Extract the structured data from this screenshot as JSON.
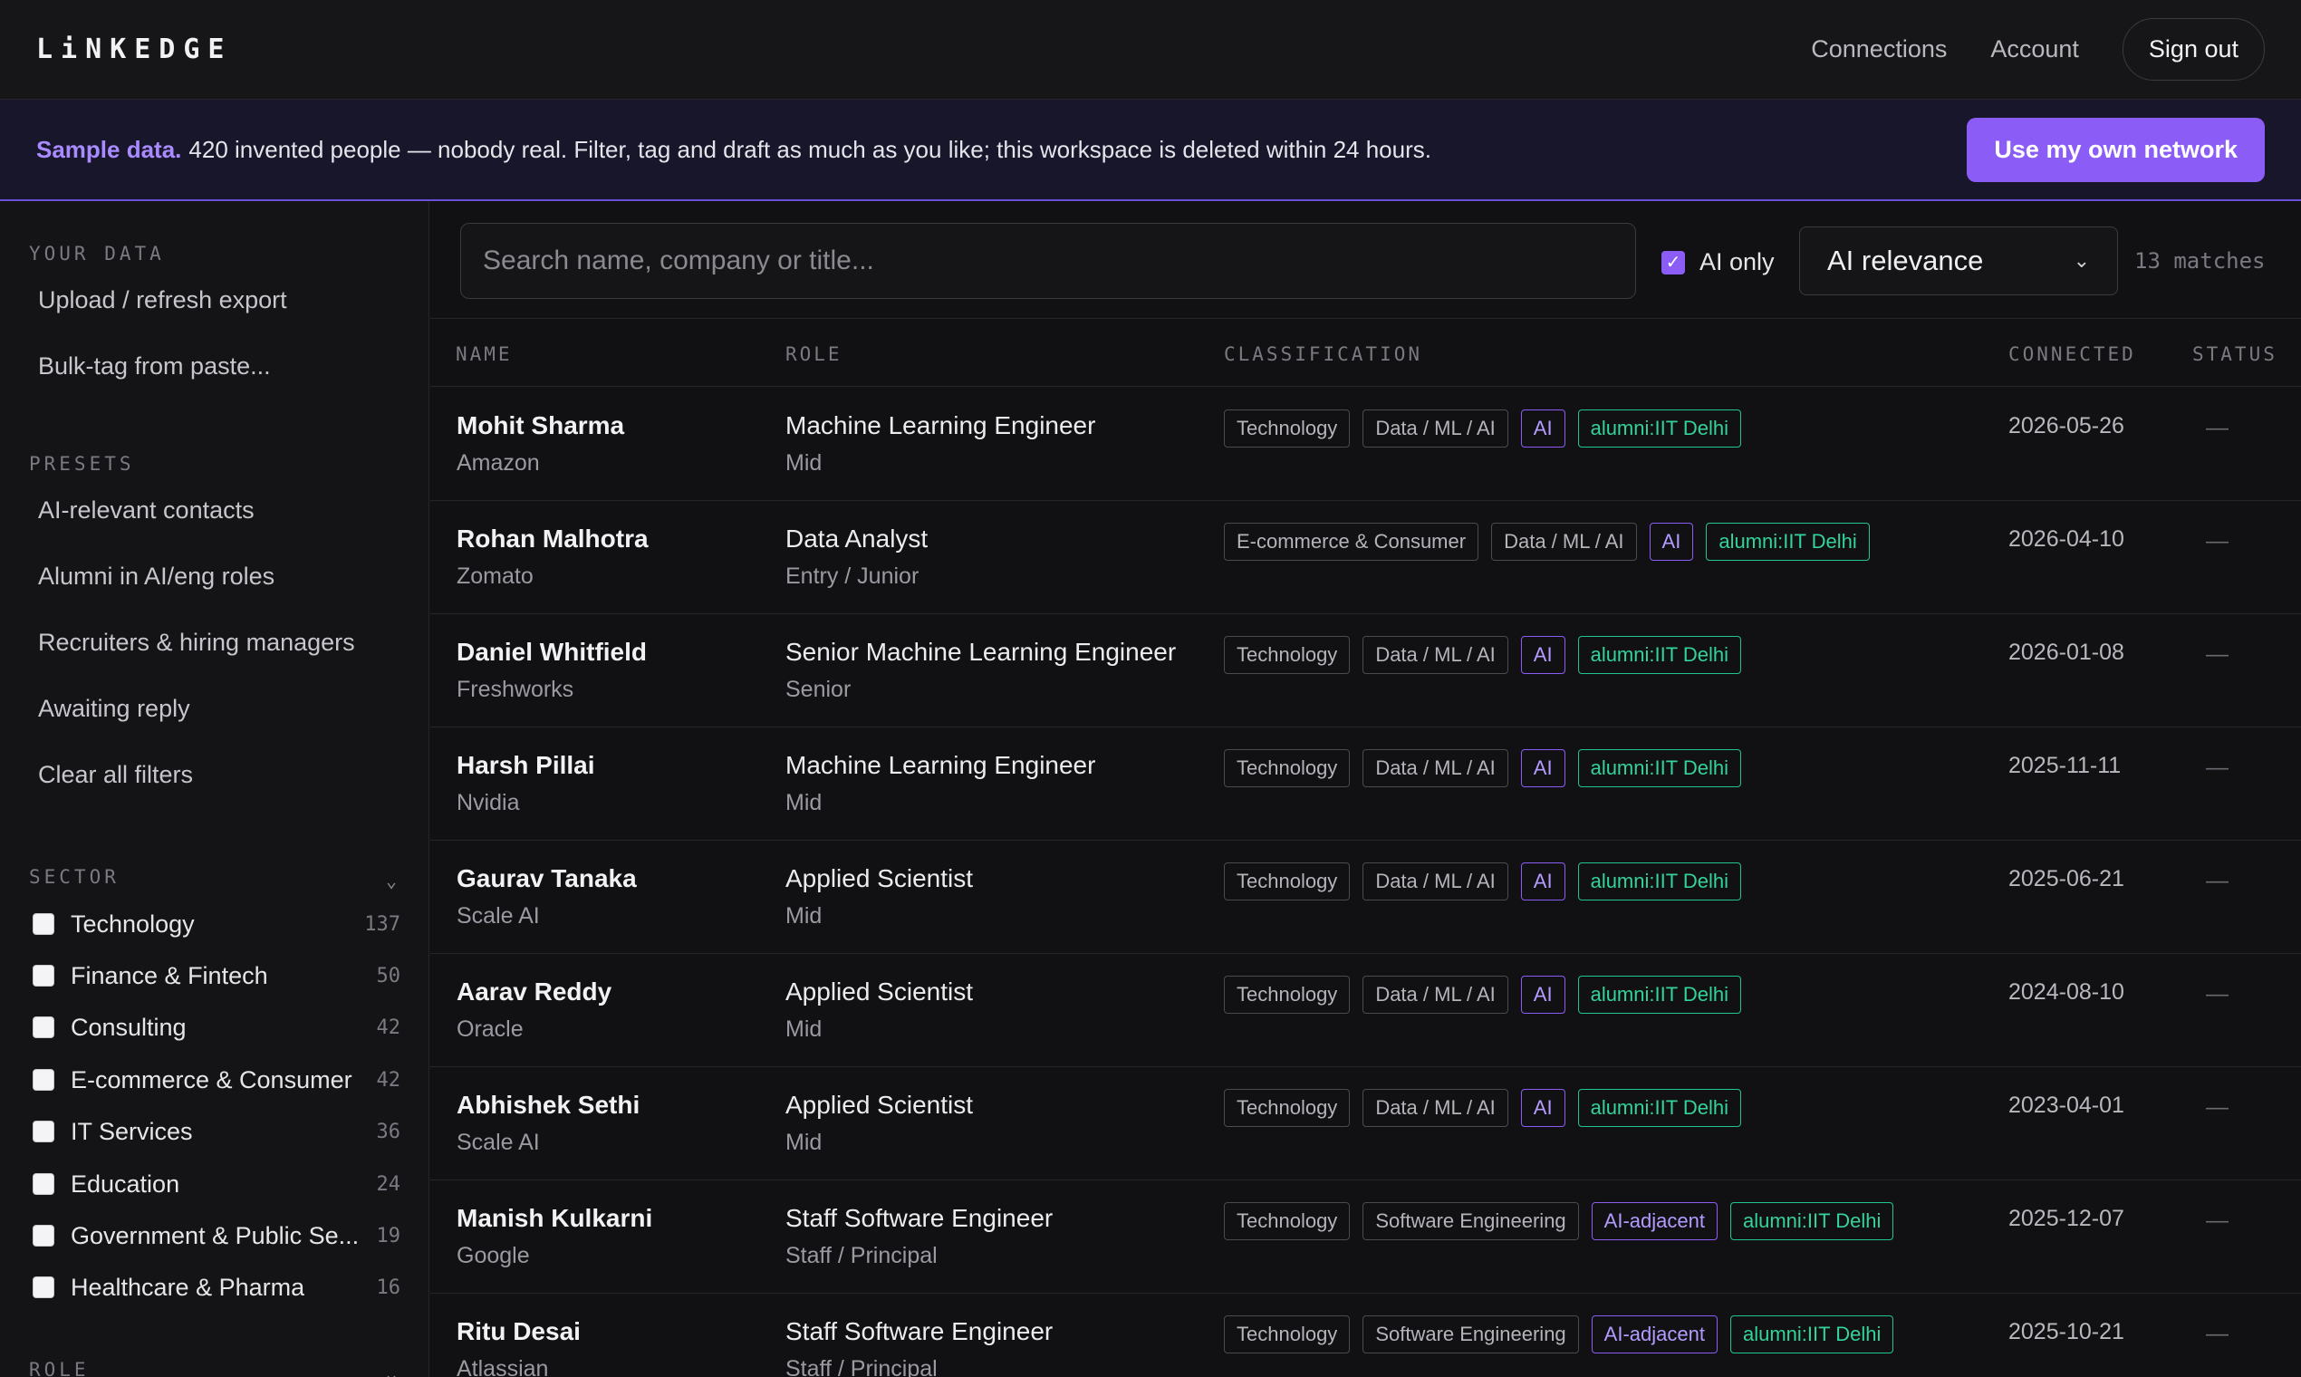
{
  "app": {
    "logo": "LiNKEDGE"
  },
  "header": {
    "nav": [
      "Connections",
      "Account"
    ],
    "signout_label": "Sign out"
  },
  "banner": {
    "strong": "Sample data.",
    "text": "420 invented people — nobody real. Filter, tag and draft as much as you like; this workspace is deleted within 24 hours.",
    "button_label": "Use my own network"
  },
  "sidebar": {
    "your_data": {
      "label": "YOUR DATA",
      "items": [
        "Upload / refresh export",
        "Bulk-tag from paste..."
      ]
    },
    "presets": {
      "label": "PRESETS",
      "items": [
        "AI-relevant contacts",
        "Alumni in AI/eng roles",
        "Recruiters & hiring managers",
        "Awaiting reply",
        "Clear all filters"
      ]
    },
    "sector": {
      "label": "SECTOR",
      "items": [
        {
          "label": "Technology",
          "count": "137"
        },
        {
          "label": "Finance & Fintech",
          "count": "50"
        },
        {
          "label": "Consulting",
          "count": "42"
        },
        {
          "label": "E-commerce & Consumer",
          "count": "42"
        },
        {
          "label": "IT Services",
          "count": "36"
        },
        {
          "label": "Education",
          "count": "24"
        },
        {
          "label": "Government & Public Se...",
          "count": "19"
        },
        {
          "label": "Healthcare & Pharma",
          "count": "16"
        }
      ]
    },
    "role": {
      "label": "ROLE"
    }
  },
  "toolbar": {
    "search_placeholder": "Search name, company or title...",
    "ai_only_label": "AI only",
    "ai_only_checked": true,
    "sort_value": "AI relevance",
    "matches": "13 matches"
  },
  "table": {
    "columns": [
      "NAME",
      "ROLE",
      "CLASSIFICATION",
      "CONNECTED",
      "STATUS"
    ],
    "rows": [
      {
        "name": "Mohit Sharma",
        "company": "Amazon",
        "title": "Machine Learning Engineer",
        "level": "Mid",
        "sector": "Technology",
        "function": "Data / ML / AI",
        "ai": "AI",
        "alumni": "alumni:IIT Delhi",
        "connected": "2026-05-26",
        "status": "—"
      },
      {
        "name": "Rohan Malhotra",
        "company": "Zomato",
        "title": "Data Analyst",
        "level": "Entry / Junior",
        "sector": "E-commerce & Consumer",
        "function": "Data / ML / AI",
        "ai": "AI",
        "alumni": "alumni:IIT Delhi",
        "connected": "2026-04-10",
        "status": "—"
      },
      {
        "name": "Daniel Whitfield",
        "company": "Freshworks",
        "title": "Senior Machine Learning Engineer",
        "level": "Senior",
        "sector": "Technology",
        "function": "Data / ML / AI",
        "ai": "AI",
        "alumni": "alumni:IIT Delhi",
        "connected": "2026-01-08",
        "status": "—"
      },
      {
        "name": "Harsh Pillai",
        "company": "Nvidia",
        "title": "Machine Learning Engineer",
        "level": "Mid",
        "sector": "Technology",
        "function": "Data / ML / AI",
        "ai": "AI",
        "alumni": "alumni:IIT Delhi",
        "connected": "2025-11-11",
        "status": "—"
      },
      {
        "name": "Gaurav Tanaka",
        "company": "Scale AI",
        "title": "Applied Scientist",
        "level": "Mid",
        "sector": "Technology",
        "function": "Data / ML / AI",
        "ai": "AI",
        "alumni": "alumni:IIT Delhi",
        "connected": "2025-06-21",
        "status": "—"
      },
      {
        "name": "Aarav Reddy",
        "company": "Oracle",
        "title": "Applied Scientist",
        "level": "Mid",
        "sector": "Technology",
        "function": "Data / ML / AI",
        "ai": "AI",
        "alumni": "alumni:IIT Delhi",
        "connected": "2024-08-10",
        "status": "—"
      },
      {
        "name": "Abhishek Sethi",
        "company": "Scale AI",
        "title": "Applied Scientist",
        "level": "Mid",
        "sector": "Technology",
        "function": "Data / ML / AI",
        "ai": "AI",
        "alumni": "alumni:IIT Delhi",
        "connected": "2023-04-01",
        "status": "—"
      },
      {
        "name": "Manish Kulkarni",
        "company": "Google",
        "title": "Staff Software Engineer",
        "level": "Staff / Principal",
        "sector": "Technology",
        "function": "Software Engineering",
        "ai": "AI-adjacent",
        "alumni": "alumni:IIT Delhi",
        "connected": "2025-12-07",
        "status": "—"
      },
      {
        "name": "Ritu Desai",
        "company": "Atlassian",
        "title": "Staff Software Engineer",
        "level": "Staff / Principal",
        "sector": "Technology",
        "function": "Software Engineering",
        "ai": "AI-adjacent",
        "alumni": "alumni:IIT Delhi",
        "connected": "2025-10-21",
        "status": "—"
      }
    ]
  }
}
